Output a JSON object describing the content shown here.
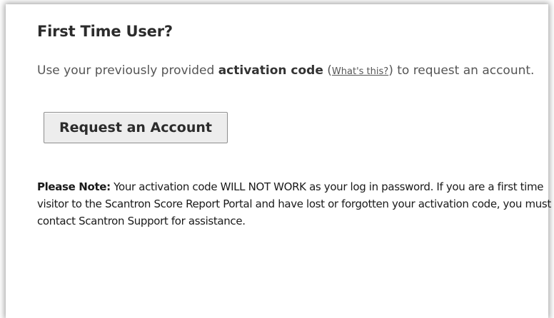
{
  "first_time": {
    "heading": "First Time User?",
    "intro_before": "Use your previously provided ",
    "intro_strong": "activation code",
    "intro_open_paren": " (",
    "help_link": "What's this?",
    "intro_after": ") to request an account.",
    "request_button": "Request an Account"
  },
  "note": {
    "label": "Please Note:",
    "text": " Your activation code WILL NOT WORK as your log in password. If you are a first time visitor to the Scantron Score Report Portal and have lost or forgotten your activation code, you must contact Scantron Support for assistance."
  }
}
